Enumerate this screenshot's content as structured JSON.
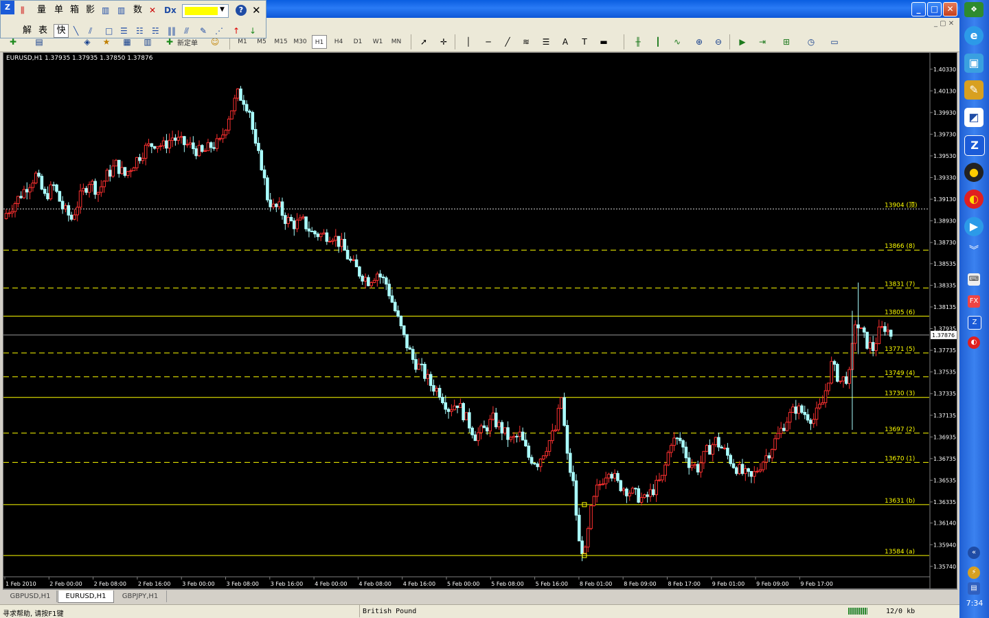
{
  "window": {
    "minimize": "_",
    "maximize": "□",
    "close": "✕"
  },
  "float_panel": {
    "row1": [
      "量",
      "单",
      "箱",
      "影",
      "数"
    ],
    "row2": [
      "解",
      "表",
      "快"
    ],
    "help": "?",
    "close": "✕",
    "color_value": "#ffff00"
  },
  "toolbar": {
    "timeframes": [
      "M1",
      "M5",
      "M15",
      "M30",
      "H1",
      "H4",
      "D1",
      "W1",
      "MN"
    ],
    "active_timeframe": "H1",
    "new_order_label": "新定单"
  },
  "chart_data": {
    "type": "candlestick",
    "title": "EURUSD,H1  1.37935 1.37935 1.37850 1.37876",
    "current_price": "1.37876",
    "price_axis_labels": [
      "1.40330",
      "1.40130",
      "1.39930",
      "1.39730",
      "1.39530",
      "1.39330",
      "1.39130",
      "1.38930",
      "1.38730",
      "1.38535",
      "1.38335",
      "1.38135",
      "1.37935",
      "1.37735",
      "1.37535",
      "1.37335",
      "1.37135",
      "1.36935",
      "1.36735",
      "1.36535",
      "1.36335",
      "1.36140",
      "1.35940",
      "1.35740"
    ],
    "time_axis_labels": [
      "1 Feb 2010",
      "2 Feb 00:00",
      "2 Feb 08:00",
      "2 Feb 16:00",
      "3 Feb 00:00",
      "3 Feb 08:00",
      "3 Feb 16:00",
      "4 Feb 00:00",
      "4 Feb 08:00",
      "4 Feb 16:00",
      "5 Feb 00:00",
      "5 Feb 08:00",
      "5 Feb 16:00",
      "8 Feb 01:00",
      "8 Feb 09:00",
      "8 Feb 17:00",
      "9 Feb 01:00",
      "9 Feb 09:00",
      "9 Feb 17:00"
    ],
    "ylim": [
      1.3565,
      1.4043
    ],
    "bull_color": "#ff3030",
    "bear_color": "#aaffff",
    "level_color": "#ffff00",
    "fib_levels": [
      {
        "label": "13904 (顶)",
        "price": 1.3904,
        "style": "dotted-white"
      },
      {
        "label": "13866 (8)",
        "price": 1.3866,
        "style": "dashed"
      },
      {
        "label": "13831 (7)",
        "price": 1.3831,
        "style": "dashed"
      },
      {
        "label": "13805 (6)",
        "price": 1.3805,
        "style": "solid"
      },
      {
        "label": "13771 (5)",
        "price": 1.3771,
        "style": "dashed"
      },
      {
        "label": "13749 (4)",
        "price": 1.3749,
        "style": "dashed"
      },
      {
        "label": "13730 (3)",
        "price": 1.373,
        "style": "solid"
      },
      {
        "label": "13697 (2)",
        "price": 1.3697,
        "style": "dashed"
      },
      {
        "label": "13670 (1)",
        "price": 1.367,
        "style": "dashed"
      },
      {
        "label": "13631 (b)",
        "price": 1.3631,
        "style": "solid"
      },
      {
        "label": "13584 (a)",
        "price": 1.3584,
        "style": "solid"
      }
    ],
    "close_path": [
      [
        0,
        1.39
      ],
      [
        3,
        1.391
      ],
      [
        7,
        1.3925
      ],
      [
        10,
        1.3935
      ],
      [
        13,
        1.3915
      ],
      [
        16,
        1.3925
      ],
      [
        19,
        1.3905
      ],
      [
        22,
        1.3895
      ],
      [
        25,
        1.3915
      ],
      [
        28,
        1.393
      ],
      [
        31,
        1.392
      ],
      [
        34,
        1.3935
      ],
      [
        37,
        1.3945
      ],
      [
        40,
        1.3935
      ],
      [
        44,
        1.395
      ],
      [
        47,
        1.396
      ],
      [
        50,
        1.3965
      ],
      [
        53,
        1.3962
      ],
      [
        56,
        1.397
      ],
      [
        59,
        1.3965
      ],
      [
        62,
        1.3962
      ],
      [
        66,
        1.3955
      ],
      [
        69,
        1.3962
      ],
      [
        72,
        1.3965
      ],
      [
        75,
        1.399
      ],
      [
        78,
        1.401
      ],
      [
        80,
        1.4005
      ],
      [
        82,
        1.3995
      ],
      [
        84,
        1.396
      ],
      [
        86,
        1.3945
      ],
      [
        88,
        1.3915
      ],
      [
        90,
        1.3905
      ],
      [
        92,
        1.3905
      ],
      [
        94,
        1.3895
      ],
      [
        97,
        1.389
      ],
      [
        100,
        1.3892
      ],
      [
        103,
        1.3882
      ],
      [
        106,
        1.388
      ],
      [
        110,
        1.388
      ],
      [
        113,
        1.387
      ],
      [
        116,
        1.3855
      ],
      [
        119,
        1.3845
      ],
      [
        122,
        1.3838
      ],
      [
        125,
        1.3845
      ],
      [
        128,
        1.3835
      ],
      [
        131,
        1.381
      ],
      [
        134,
        1.3785
      ],
      [
        137,
        1.3765
      ],
      [
        140,
        1.3755
      ],
      [
        143,
        1.3742
      ],
      [
        146,
        1.3735
      ],
      [
        149,
        1.372
      ],
      [
        152,
        1.3725
      ],
      [
        155,
        1.371
      ],
      [
        158,
        1.3695
      ],
      [
        161,
        1.37
      ],
      [
        164,
        1.371
      ],
      [
        167,
        1.37
      ],
      [
        170,
        1.369
      ],
      [
        173,
        1.3695
      ],
      [
        176,
        1.3675
      ],
      [
        179,
        1.367
      ],
      [
        182,
        1.3685
      ],
      [
        185,
        1.37
      ],
      [
        187,
        1.373
      ],
      [
        189,
        1.3675
      ],
      [
        191,
        1.365
      ],
      [
        193,
        1.3595
      ],
      [
        195,
        1.3586
      ],
      [
        197,
        1.3625
      ],
      [
        199,
        1.3645
      ],
      [
        201,
        1.3655
      ],
      [
        203,
        1.3665
      ],
      [
        206,
        1.365
      ],
      [
        209,
        1.3645
      ],
      [
        212,
        1.364
      ],
      [
        215,
        1.3635
      ],
      [
        218,
        1.3645
      ],
      [
        221,
        1.3655
      ],
      [
        224,
        1.369
      ],
      [
        227,
        1.369
      ],
      [
        230,
        1.367
      ],
      [
        233,
        1.3665
      ],
      [
        236,
        1.368
      ],
      [
        239,
        1.369
      ],
      [
        242,
        1.368
      ],
      [
        245,
        1.3668
      ],
      [
        248,
        1.366
      ],
      [
        251,
        1.3655
      ],
      [
        254,
        1.3668
      ],
      [
        257,
        1.368
      ],
      [
        260,
        1.3695
      ],
      [
        263,
        1.371
      ],
      [
        266,
        1.372
      ],
      [
        269,
        1.3715
      ],
      [
        272,
        1.371
      ],
      [
        275,
        1.3725
      ],
      [
        278,
        1.376
      ],
      [
        281,
        1.3745
      ],
      [
        284,
        1.375
      ],
      [
        286,
        1.38
      ],
      [
        288,
        1.379
      ],
      [
        290,
        1.378
      ],
      [
        292,
        1.3775
      ],
      [
        294,
        1.379
      ],
      [
        296,
        1.3795
      ],
      [
        298,
        1.3788
      ]
    ],
    "annotation_spikes": [
      {
        "bar": 287,
        "high": 1.3836,
        "low": 1.377
      },
      {
        "bar": 285,
        "high": 1.381,
        "low": 1.37
      }
    ]
  },
  "tabs": [
    "GBPUSD,H1",
    "EURUSD,H1",
    "GBPJPY,H1"
  ],
  "active_tab": "EURUSD,H1",
  "status": {
    "help": "寻求帮助, 请按F1键",
    "profile": "British Pound",
    "traffic": "12/0 kb"
  },
  "sidebar": {
    "clock": "7:34"
  }
}
